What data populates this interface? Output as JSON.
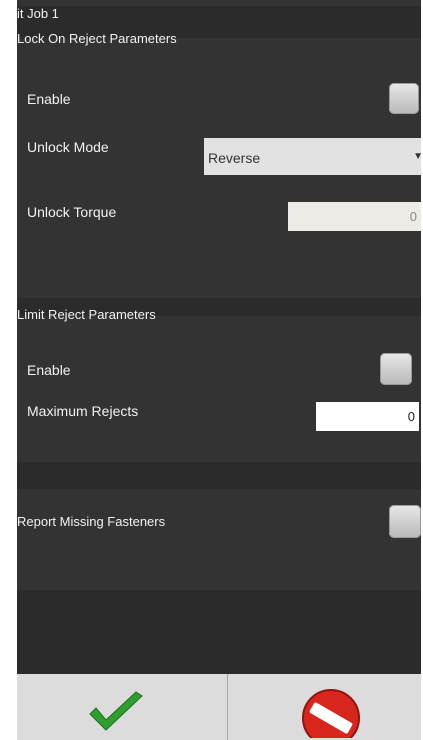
{
  "window": {
    "title": "it Job 1"
  },
  "lock_on_reject": {
    "header": "Lock On Reject Parameters",
    "enable_label": "Enable",
    "unlock_mode_label": "Unlock Mode",
    "unlock_mode_value": "Reverse",
    "unlock_torque_label": "Unlock Torque",
    "unlock_torque_value": "0"
  },
  "limit_reject": {
    "header": "Limit Reject Parameters",
    "enable_label": "Enable",
    "max_rejects_label": "Maximum Rejects",
    "max_rejects_value": "0"
  },
  "report_missing": {
    "label": "Report Missing Fasteners"
  },
  "colors": {
    "panel": "#333333",
    "band": "#2b2b2b",
    "accept": "#2e9e2e",
    "cancel": "#d9261c"
  },
  "icons": {
    "accept": "checkmark-icon",
    "cancel": "no-entry-icon",
    "dropdown": "caret-down-icon"
  }
}
